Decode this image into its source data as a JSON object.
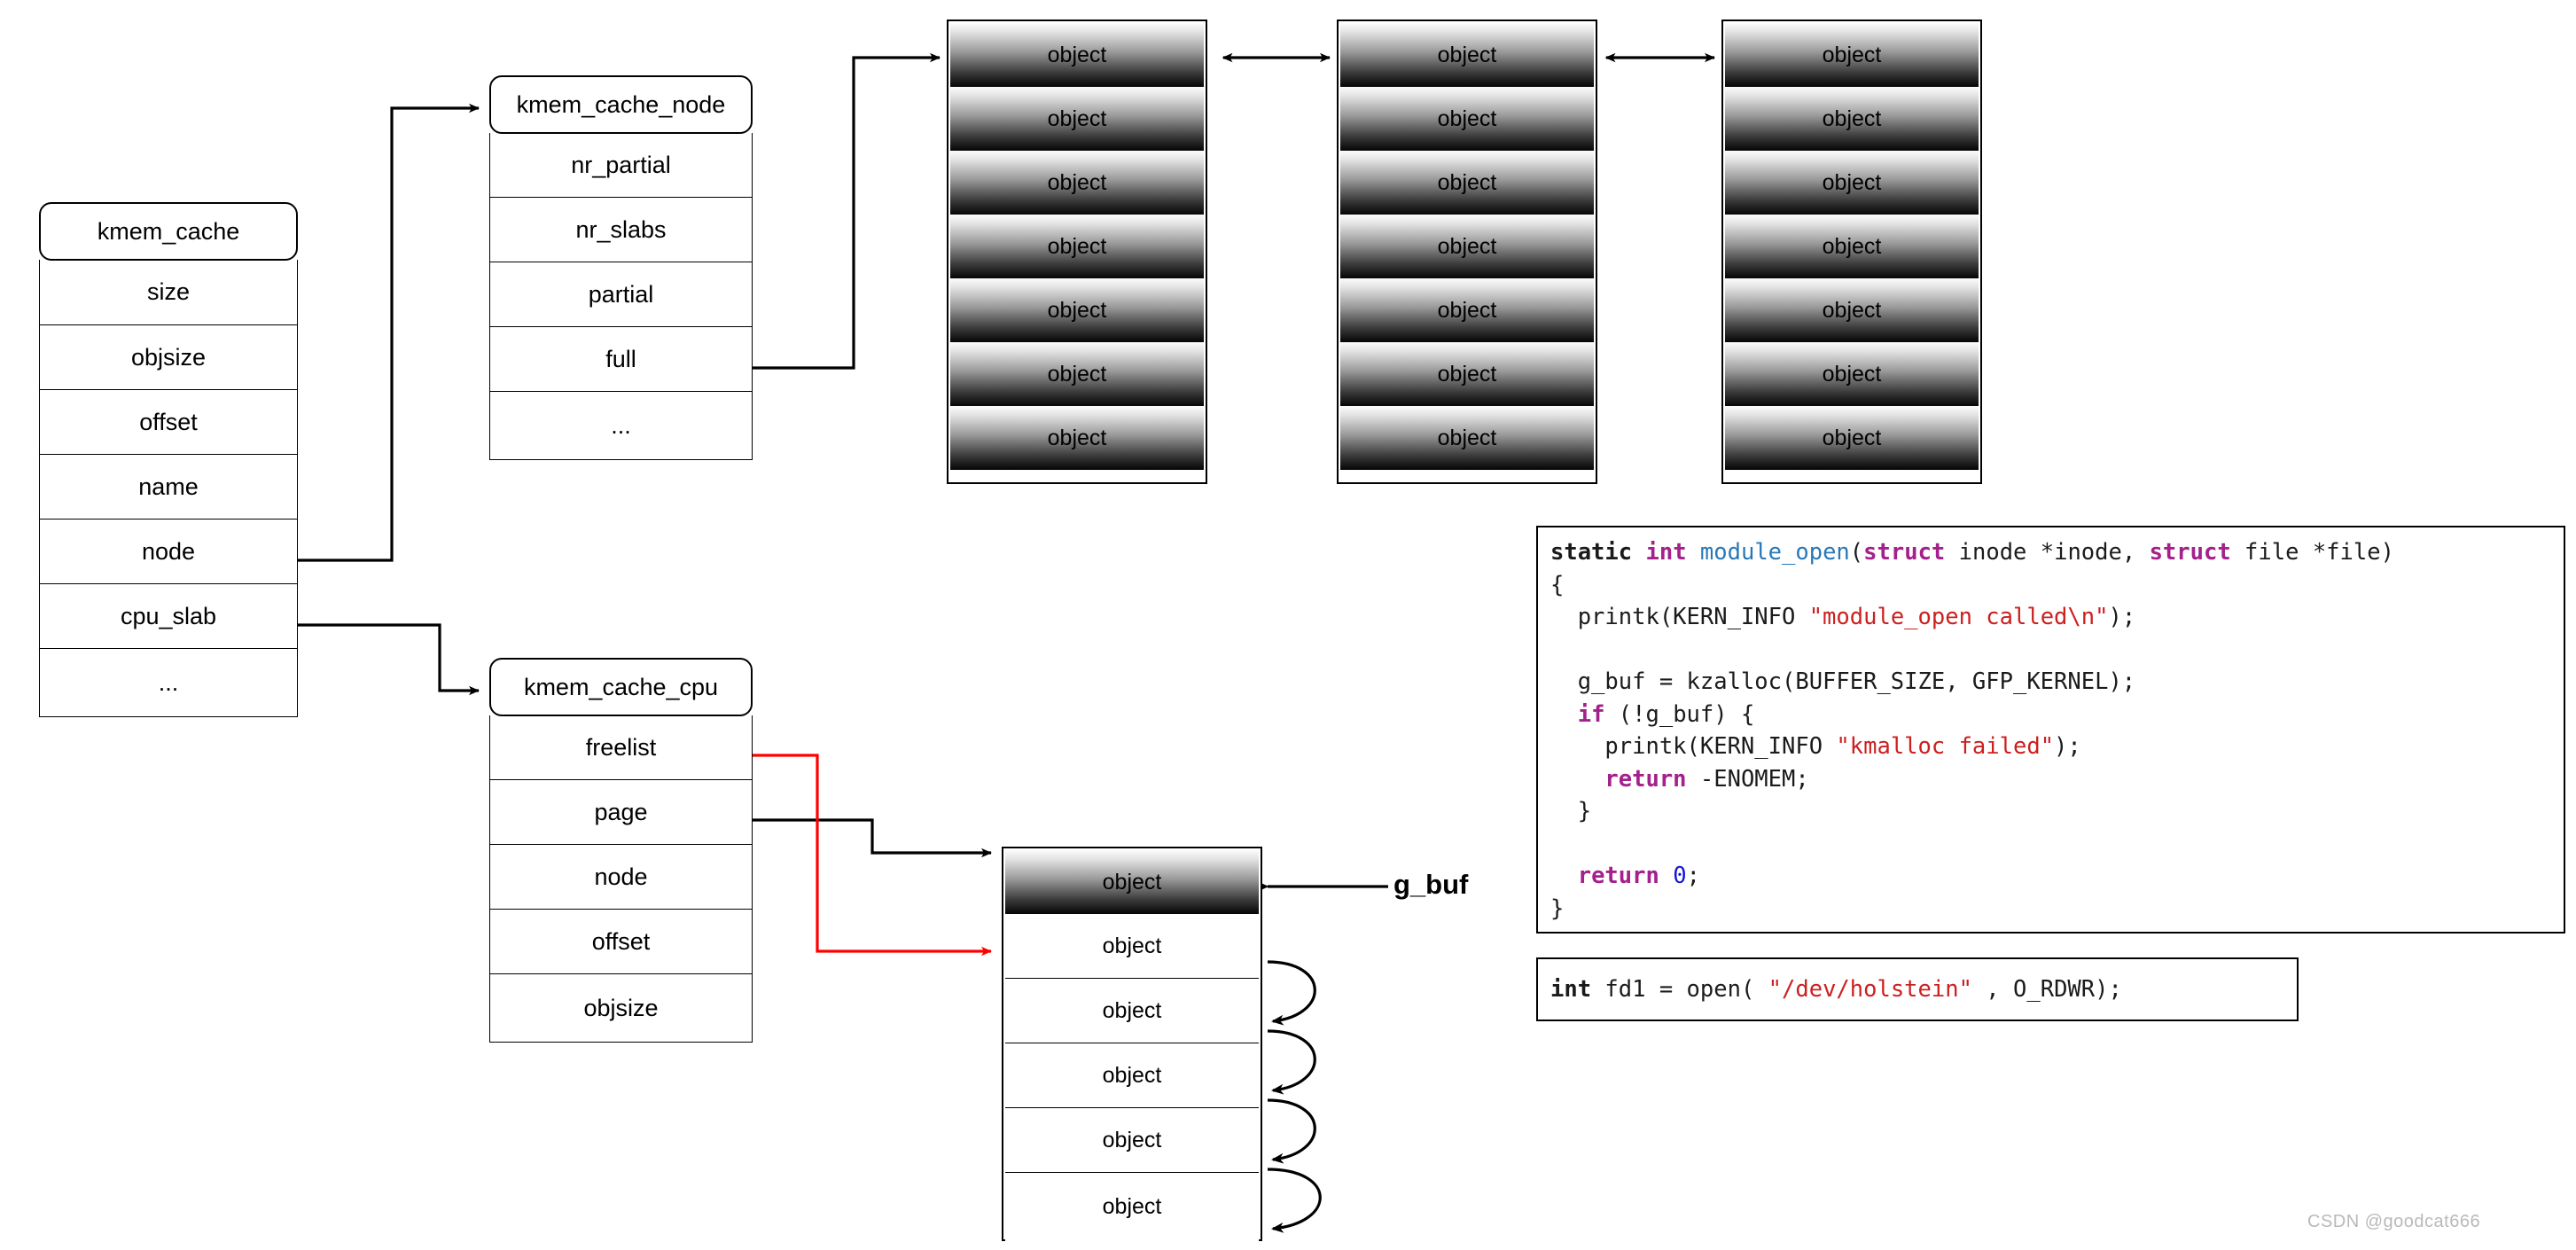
{
  "diagram": {
    "title": "Linux SLUB allocator structures",
    "structs": [
      {
        "id": "kmem_cache",
        "name": "kmem_cache",
        "fields": [
          "size",
          "objsize",
          "offset",
          "name",
          "node",
          "cpu_slab",
          "..."
        ]
      },
      {
        "id": "kmem_cache_node",
        "name": "kmem_cache_node",
        "fields": [
          "nr_partial",
          "nr_slabs",
          "partial",
          "full",
          "..."
        ]
      },
      {
        "id": "kmem_cache_cpu",
        "name": "kmem_cache_cpu",
        "fields": [
          "freelist",
          "page",
          "node",
          "offset",
          "objsize"
        ]
      }
    ],
    "slabs": [
      {
        "id": "slab-1",
        "objects": [
          "object",
          "object",
          "object",
          "object",
          "object",
          "object",
          "object"
        ]
      },
      {
        "id": "slab-2",
        "objects": [
          "object",
          "object",
          "object",
          "object",
          "object",
          "object",
          "object"
        ]
      },
      {
        "id": "slab-3",
        "objects": [
          "object",
          "object",
          "object",
          "object",
          "object",
          "object",
          "object"
        ]
      },
      {
        "id": "slab-cpu",
        "objects": [
          "object",
          "object",
          "object",
          "object",
          "object",
          "object"
        ]
      }
    ],
    "labels": {
      "g_buf": "g_buf"
    },
    "colors": {
      "freelist_link": "#ff0000",
      "outline": "#000000",
      "object_fill_top": "#fbfbfb",
      "object_fill_bottom": "#050505"
    }
  },
  "code_panels": [
    {
      "id": "module-open",
      "lines": [
        "static int module_open(struct inode *inode, struct file *file)",
        "{",
        "  printk(KERN_INFO \"module_open called\\n\");",
        "",
        "  g_buf = kzalloc(BUFFER_SIZE, GFP_KERNEL);",
        "  if (!g_buf) {",
        "    printk(KERN_INFO \"kmalloc failed\");",
        "    return -ENOMEM;",
        "  }",
        "",
        "  return 0;",
        "}"
      ]
    },
    {
      "id": "open-call",
      "lines": [
        "int fd1 = open( \"/dev/holstein\" , O_RDWR);"
      ]
    }
  ],
  "watermark": "CSDN @goodcat666"
}
